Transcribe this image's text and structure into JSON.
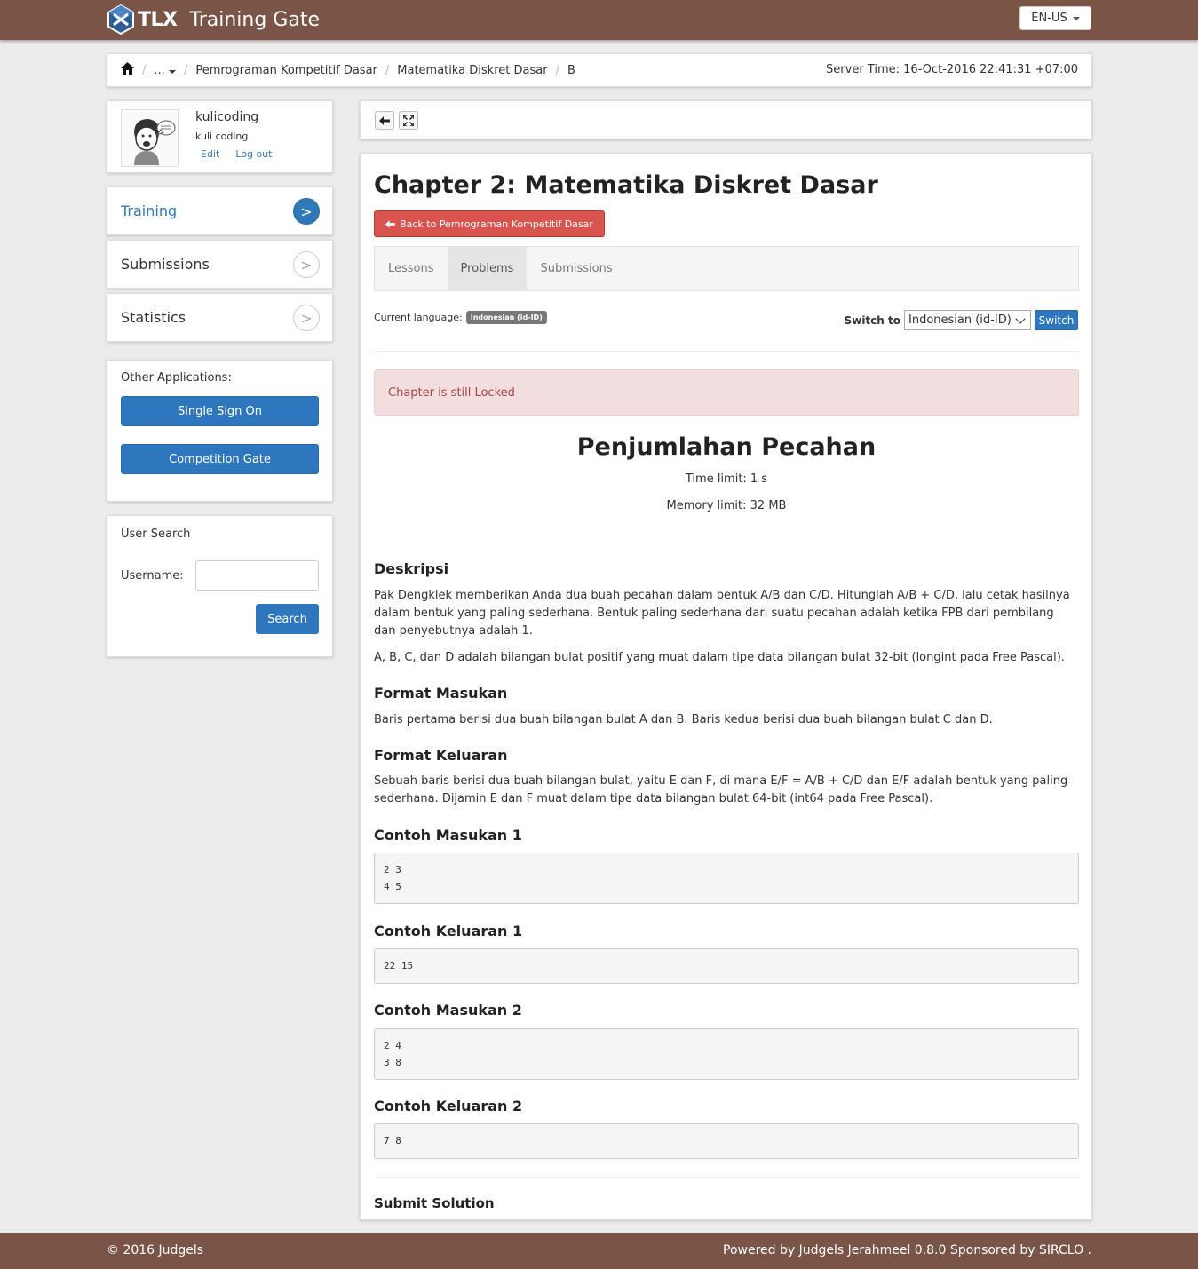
{
  "header": {
    "brand_short": "TLX",
    "brand_name": "Training Gate",
    "locale": "EN-US"
  },
  "breadcrumb": {
    "items": [
      "...",
      "Pemrograman Kompetitif Dasar",
      "Matematika Diskret Dasar",
      "B"
    ],
    "server_time": "Server Time: 16-Oct-2016 22:41:31 +07:00"
  },
  "profile": {
    "username": "kulicoding",
    "name": "kuli coding",
    "edit": "Edit",
    "logout": "Log out"
  },
  "sidebar": {
    "items": [
      {
        "label": "Training",
        "active": true
      },
      {
        "label": "Submissions",
        "active": false
      },
      {
        "label": "Statistics",
        "active": false
      }
    ],
    "chevron": ">"
  },
  "other_apps": {
    "title": "Other Applications:",
    "buttons": [
      "Single Sign On",
      "Competition Gate"
    ]
  },
  "user_search": {
    "title": "User Search",
    "username_label": "Username:",
    "username_value": "",
    "search_button": "Search"
  },
  "chapter": {
    "title": "Chapter 2: Matematika Diskret Dasar",
    "back_button": "Back to Pemrograman Kompetitif Dasar",
    "tabs": [
      "Lessons",
      "Problems",
      "Submissions"
    ],
    "active_tab": "Problems"
  },
  "language": {
    "current_label": "Current language:",
    "current_badge": "Indonesian (id-ID)",
    "switch_label": "Switch to",
    "selected": "Indonesian (id-ID)",
    "switch_button": "Switch"
  },
  "alert": "Chapter is still Locked",
  "problem": {
    "title": "Penjumlahan Pecahan",
    "time_limit": "Time limit: 1 s",
    "memory_limit": "Memory limit: 32 MB",
    "desc_heading": "Deskripsi",
    "desc_p1": "Pak Dengklek memberikan Anda dua buah pecahan dalam bentuk A/B dan C/D. Hitunglah A/B + C/D, lalu cetak hasilnya dalam bentuk yang paling sederhana. Bentuk paling sederhana dari suatu pecahan adalah ketika FPB dari pembilang dan penyebutnya adalah 1.",
    "desc_p2": "A, B, C, dan D adalah bilangan bulat positif yang muat dalam tipe data bilangan bulat 32-bit (longint pada Free Pascal).",
    "input_heading": "Format Masukan",
    "input_text": "Baris pertama berisi dua buah bilangan bulat A dan B. Baris kedua berisi dua buah bilangan bulat C dan D.",
    "output_heading": "Format Keluaran",
    "output_text": "Sebuah baris berisi dua buah bilangan bulat, yaitu E dan F, di mana E/F = A/B + C/D dan E/F adalah bentuk yang paling sederhana. Dijamin E dan F muat dalam tipe data bilangan bulat 64-bit (int64 pada Free Pascal).",
    "samples": [
      {
        "heading": "Contoh Masukan 1",
        "content": "2 3\n4 5"
      },
      {
        "heading": "Contoh Keluaran 1",
        "content": "22 15"
      },
      {
        "heading": "Contoh Masukan 2",
        "content": "2 4\n3 8"
      },
      {
        "heading": "Contoh Keluaran 2",
        "content": "7 8"
      }
    ],
    "submit_heading": "Submit Solution"
  },
  "footer": {
    "copyright": "© 2016 Judgels",
    "powered": "Powered by Judgels Jerahmeel 0.8.0 Sponsored by SIRCLO ."
  },
  "colors": {
    "brand_brown": "#7a5547",
    "primary_blue": "#2e77be",
    "danger_red": "#d9534f",
    "alert_bg": "#f2dede"
  }
}
